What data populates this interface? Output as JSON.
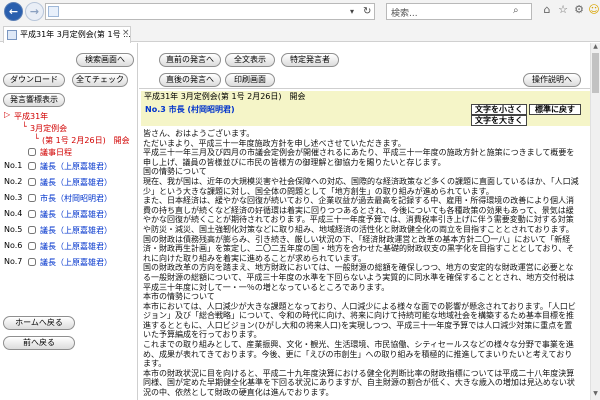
{
  "browser": {
    "address_text": "",
    "search_placeholder": "検索...",
    "tab_title": "平成31年 3月定例会(第 1号 ...",
    "tab_close": "×",
    "back_glyph": "←",
    "forward_glyph": "→",
    "dropdown_glyph": "▾",
    "refresh_glyph": "↻",
    "search_glyph": "⌕",
    "home_glyph": "⌂",
    "star_glyph": "☆",
    "gear_glyph": "⚙",
    "smile_glyph": "☺"
  },
  "left": {
    "buttons": {
      "search_screen": "検索画面へ",
      "download": "ダウンロード",
      "check_all": "全てチェック",
      "speaker_list": "発言響標表示",
      "home": "ホームへ戻る",
      "prev": "前へ戻る"
    },
    "tree": {
      "root": "平成31年",
      "session": "3月定例会",
      "day": "(第 1号 2月26日)　開会",
      "schedule": "議事日程",
      "items": [
        {
          "no": "No.1",
          "label": "議長（上原嘉雄君）"
        },
        {
          "no": "No.2",
          "label": "議長（上原嘉雄君）"
        },
        {
          "no": "No.3",
          "label": "市長（村岡昭明君）"
        },
        {
          "no": "No.4",
          "label": "議長（上原嘉雄君）"
        },
        {
          "no": "No.5",
          "label": "議長（上原嘉雄君）"
        },
        {
          "no": "No.6",
          "label": "議長（上原嘉雄君）"
        },
        {
          "no": "No.7",
          "label": "議長（上原嘉雄君）"
        }
      ]
    }
  },
  "right": {
    "buttons": {
      "prev_speaker": "直前の発言へ",
      "all_text": "全文表示",
      "specific_speaker": "特定発言者",
      "next_speaker": "直後の発言へ",
      "print": "印刷画面",
      "help": "操作説明へ"
    },
    "meeting_title": "平成31年 3月定例会(第 1号 2月26日)　開会",
    "speaker_label": "No.3 市長 (村岡昭明君)",
    "font_smaller": "文字を小さく",
    "font_reset": "標準に戻す",
    "font_larger": "文字を大きく",
    "speech": [
      "皆さん、おはようございます。",
      "ただいまより、平成三十一年度施政方針を申し述べさせていただきます。",
      "平成三十一年三月及び四月の市議会定例会が開催されるにあたり、平成三十一年度の施政方針と施策につきまして概要を申し上げ、議員の皆様並びに市民の皆様方の御理解と御協力を賜りたいと存じます。",
      "国の情勢について",
      "現在、我が国は、近年の大規模災害や社会保障への対応、国際的な経済政策など多くの課題に直面しているほか、「人口減少」という大きな課題に対し、国全体の問題として「地方創生」の取り組みが進められています。",
      "また、日本経済は、緩やかな回復が続いており、企業収益が過去最高を記録する中、雇用・所得環境の改善により個人消費の持ち直しが続くなど経済の好循環は着実に回りつつあるとされ、今後についても各種政策の効果もあって、景気は緩やかな回復が続くことが期待されております。平成三十一年度予算では、消費税率引き上げに伴う需要変動に対する対策や防災・減災、国土強靭化対策などに取り組み、地域経済の活性化と財政健全化の両立を目指すこととされております。",
      "国の財政は債務残高が膨らみ、引き続き、厳しい状況の下、「経済財政運営と改革の基本方針二〇一八」において「新経済・財政再生計画」を策定し、二〇二五年度の国・地方を合わせた基礎的財政収支の黒字化を目指すこととしており、それに向けた取り組みを着実に進めることが求められています。",
      "国の財政改革の方向を踏まえ、地方財政においては、一般財源の総額を確保しつつ、地方の安定的な財政運営に必要となる一般財源の総額について、平成三十年度の水準を下回らないよう実質的に同水準を確保することとされ、地方交付税は平成三十年度に対して一・一％の増となっているところであります。",
      "本市の情勢について",
      "本市においては、人口減少が大きな課題となっており、人口減少による様々な面での影響が懸念されております。「人口ビジョン」及び「総合戦略」について、令和の時代に向け、将来に向けて持続可能な地域社会を構築するため基本目標を推進するとともに、人口ビジョン(ひがし大和の将来人口)を実現しつつ、平成三十一年度予算では人口減少対策に重点を置いた予算編成を行っております。",
      "これまでの取り組みとして、産業振興、文化・観光、生活環境、市民協働、シティセールスなどの様々な分野で事業を進め、成果が表れてきております。今後、更に「えびの市創生」への取り組みを積極的に推進してまいりたいと考えております。",
      "本市の財政状況に目を向けると、平成二十九年度決算における健全化判断比率の財政指標については平成二十八年度決算同様、国が定めた早期健全化基準を下回る状況にありますが、自主財源の割合が低く、大きな歳入の増加は見込めない状況の中、依然として財政の硬直化は進んでおります。"
    ]
  },
  "scroll": {
    "up": "▲",
    "down": "▼"
  }
}
